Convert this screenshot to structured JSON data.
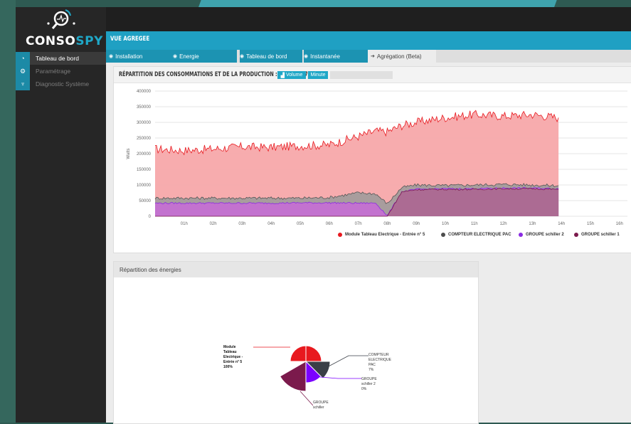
{
  "app": {
    "logo_left": "CONSO",
    "logo_right": "SPY"
  },
  "sidebar": {
    "items": [
      {
        "label": "Tableau de bord",
        "icon": "dashboard-icon",
        "active": true
      },
      {
        "label": "Paramétrage",
        "icon": "gears-icon",
        "active": false
      },
      {
        "label": "Diagnostic Système",
        "icon": "stethoscope-icon",
        "active": false
      }
    ]
  },
  "page": {
    "title": "VUE AGREGEE"
  },
  "tabs": [
    {
      "label": "Installation",
      "glyph": "◉"
    },
    {
      "label": "Energie",
      "glyph": "◉"
    },
    {
      "label": "Tableau de bord",
      "glyph": "◉"
    },
    {
      "label": "Instantanée",
      "glyph": "◉"
    },
    {
      "label": "Agrégation (Beta)",
      "glyph": "➔"
    }
  ],
  "main_panel": {
    "title": "RÉPARTITION DES CONSOMMATIONS ET DE LA PRODUCTION : 22/11/2017",
    "volume_button": "Volume",
    "minute_button": "Minute"
  },
  "pie_panel": {
    "title": "Répartition des énergies"
  },
  "colors": {
    "accent": "#1fa7c7",
    "series_red": "#e8191f",
    "series_dark": "#4d4d4d",
    "series_purple": "#8a2be2",
    "series_maroon": "#7b1a4c"
  },
  "chart_data": [
    {
      "type": "area",
      "ylabel": "Watts",
      "ylim": [
        0,
        400000
      ],
      "y_ticks": [
        "400000",
        "350000",
        "300000",
        "250000",
        "200000",
        "150000",
        "100000",
        "50000",
        "0"
      ],
      "x_ticks": [
        "01h",
        "02h",
        "03h",
        "04h",
        "05h",
        "06h",
        "07h",
        "08h",
        "09h",
        "10h",
        "11h",
        "12h",
        "13h",
        "14h",
        "15h",
        "16h"
      ],
      "x_hours": [
        0,
        1,
        2,
        3,
        4,
        5,
        6,
        7,
        7.6,
        8,
        8.5,
        9,
        10,
        11,
        12,
        13,
        13.9
      ],
      "series": [
        {
          "name": "Module Tableau Electrique - Entrée n° 5",
          "color": "#e8191f",
          "values": [
            215000,
            210000,
            215000,
            222000,
            220000,
            225000,
            228000,
            255000,
            272000,
            270000,
            290000,
            300000,
            315000,
            325000,
            320000,
            325000,
            315000
          ]
        },
        {
          "name": "COMPTEUR ELECTRIQUE PAC",
          "color": "#4d4d4d",
          "values": [
            58000,
            58000,
            58000,
            58000,
            58000,
            58000,
            60000,
            75000,
            72000,
            40000,
            92000,
            100000,
            98000,
            100000,
            102000,
            100000,
            98000
          ]
        },
        {
          "name": "GROUPE schiller 2",
          "color": "#8a2be2",
          "values": [
            42000,
            42000,
            42000,
            42000,
            42000,
            43000,
            43000,
            42000,
            42000,
            2000,
            78000,
            86000,
            88000,
            88000,
            90000,
            90000,
            88000
          ]
        },
        {
          "name": "GROUPE schiller 1",
          "color": "#7b1a4c",
          "values": [
            0,
            0,
            0,
            0,
            0,
            0,
            0,
            0,
            0,
            0,
            78000,
            85000,
            86000,
            86000,
            88000,
            88000,
            86000
          ]
        }
      ],
      "legend_position": "bottom"
    },
    {
      "type": "pie",
      "slices": [
        {
          "label": "Module Tableau Electrique - Entrée n° 5",
          "percent_label": "100%",
          "value": 100,
          "color": "#e8191f"
        },
        {
          "label": "COMPTEUR ELECTRIQUE PAC",
          "percent_label": "7%",
          "value": 7,
          "color": "#3a3f47"
        },
        {
          "label": "GROUPE schiller 2",
          "percent_label": "0%",
          "value": 0,
          "color": "#7b00ff"
        },
        {
          "label": "GROUPE schiller",
          "percent_label": "",
          "value": 0,
          "color": "#7b1a4c"
        }
      ]
    }
  ]
}
